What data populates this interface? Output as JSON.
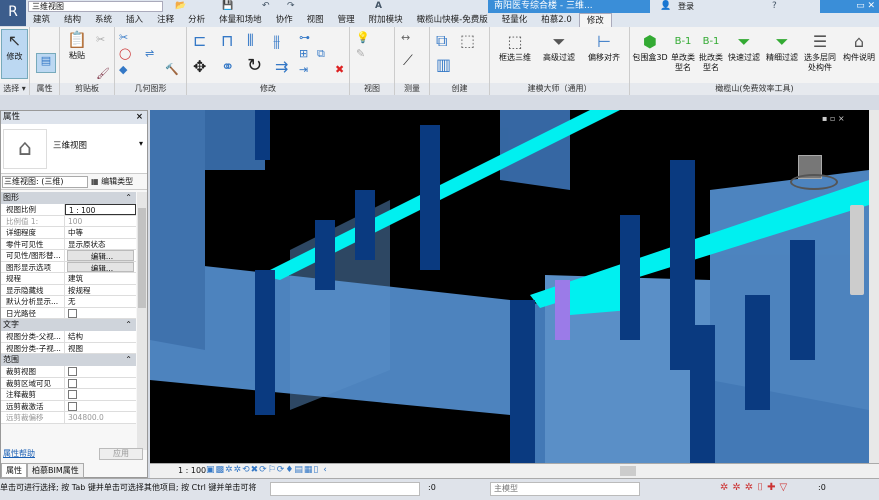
{
  "titlebar": {
    "view_name": "三维视图",
    "doc_title": "南阳医专综合楼 - 三维...",
    "login": "登录"
  },
  "tabs": [
    "建筑",
    "结构",
    "系统",
    "插入",
    "注释",
    "分析",
    "体量和场地",
    "协作",
    "视图",
    "管理",
    "附加模块",
    "橄榄山快模-免费版",
    "轻量化",
    "柏慕2.0",
    "修改"
  ],
  "ribbon": {
    "modify": "修改",
    "select": "选择 ▾",
    "properties": "属性",
    "paste": "粘贴",
    "clipboard": "剪贴板",
    "geometry": "几何图形",
    "modify_panel": "修改",
    "view": "视图",
    "measure": "测量",
    "create": "创建",
    "box3d": "框选三维",
    "adv_filter": "高级过滤",
    "offset_align": "偏移对齐",
    "master_panel": "建模大师（通用）",
    "bbox3d": "包围盒3D",
    "single_rename": "单改类型名",
    "batch_rename": "批改类型名",
    "quick_filter": "快速过滤",
    "fine_filter": "精细过滤",
    "multi_floor": "选多层同处构件",
    "comp_desc": "构件说明",
    "olive_panel": "橄榄山(免费效率工具)"
  },
  "properties": {
    "header": "属性",
    "type_name": "三维视图",
    "instance": "三维视图: (三维)",
    "edit_type": "编辑类型",
    "groups": [
      {
        "name": "图形",
        "rows": [
          [
            "视图比例",
            "1 : 100"
          ],
          [
            "比例值 1:",
            "100"
          ],
          [
            "详细程度",
            "中等"
          ],
          [
            "零件可见性",
            "显示原状态"
          ],
          [
            "可见性/图形替...",
            "编辑..."
          ],
          [
            "图形显示选项",
            "编辑..."
          ],
          [
            "规程",
            "建筑"
          ],
          [
            "显示隐藏线",
            "按规程"
          ],
          [
            "默认分析显示...",
            "无"
          ],
          [
            "日光路径",
            ""
          ]
        ]
      },
      {
        "name": "文字",
        "rows": [
          [
            "视图分类-父视...",
            "结构"
          ],
          [
            "视图分类-子视...",
            "视图"
          ]
        ]
      },
      {
        "name": "范围",
        "rows": [
          [
            "裁剪视图",
            ""
          ],
          [
            "裁剪区域可见",
            ""
          ],
          [
            "注释裁剪",
            ""
          ],
          [
            "远剪裁激活",
            ""
          ],
          [
            "远剪裁偏移",
            "304800.0"
          ]
        ]
      }
    ],
    "help": "属性帮助",
    "apply": "应用",
    "tabs": [
      "属性",
      "柏慕BIM属性"
    ]
  },
  "viewbar": {
    "scale": "1 : 100"
  },
  "status": {
    "text": "单击可进行选择; 按 Tab 键并单击可选择其他项目; 按 Ctrl 键并单击可将",
    "zero1": ":0",
    "model": "主模型",
    "zero2": ":0"
  },
  "colors": {
    "beam": "#00f0f0",
    "wall": "#5b9be0",
    "column": "#0a3a80",
    "background": "#000000"
  }
}
